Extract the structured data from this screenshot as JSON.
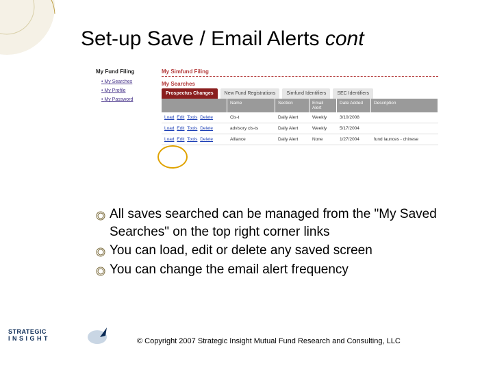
{
  "title_main": "Set-up Save / Email Alerts ",
  "title_ital": "cont",
  "sidebar": {
    "heading": "My Fund Filing",
    "links": [
      "My Searches",
      "My Profile",
      "My Password"
    ]
  },
  "sections": {
    "a": "My Simfund Filing",
    "b": "My Searches"
  },
  "tabs": [
    "Prospectus Changes",
    "New Fund Registrations",
    "Simfund Identifiers",
    "SEC Identifiers"
  ],
  "columns": {
    "name": "Name",
    "section": "Section",
    "email": "Email Alert",
    "date": "Date Added",
    "desc": "Description"
  },
  "rows": [
    {
      "actions": [
        "Load",
        "Edit",
        "Tools",
        "Delete"
      ],
      "name": "Cls-t",
      "section": "Daily Alert",
      "email": "Weekly",
      "date": "3/10/2008",
      "desc": ""
    },
    {
      "actions": [
        "Load",
        "Edit",
        "Tools",
        "Delete"
      ],
      "name": "advisory cls-ts",
      "section": "Daily Alert",
      "email": "Weekly",
      "date": "5/17/2004",
      "desc": ""
    },
    {
      "actions": [
        "Load",
        "Edit",
        "Tools",
        "Delete"
      ],
      "name": "Alliance",
      "section": "Daily Alert",
      "email": "None",
      "date": "1/27/2004",
      "desc": "fund launces - chinese"
    }
  ],
  "bullets": [
    "All saves searched can be managed from the \"My Saved Searches\" on the top right corner links",
    "You can load, edit or delete any saved screen",
    "You can change the email alert frequency"
  ],
  "brand_line1": "STRATEGIC",
  "brand_line2": "I N S I G H T",
  "copyright": "© Copyright 2007 Strategic Insight Mutual Fund Research and Consulting, LLC"
}
